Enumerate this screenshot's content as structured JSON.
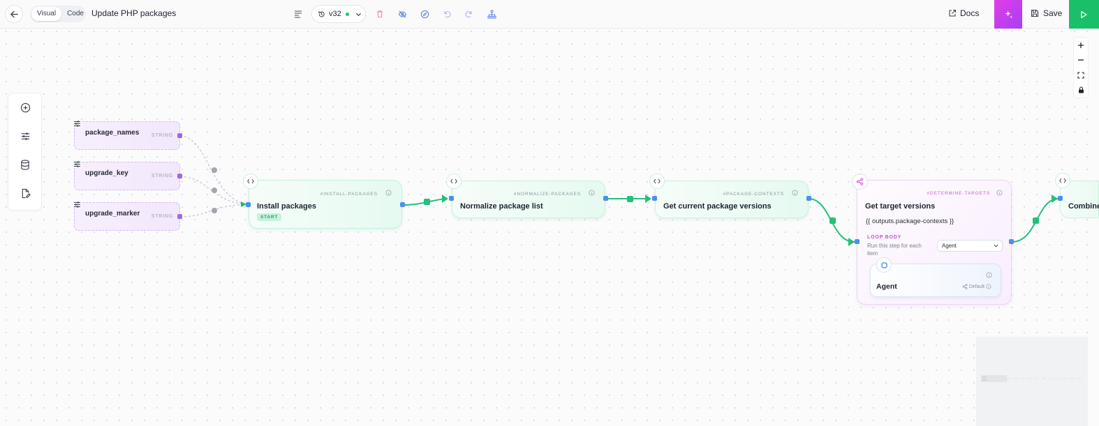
{
  "header": {
    "mode_visual": "Visual",
    "mode_code": "Code",
    "title": "Update PHP packages",
    "version": "v32",
    "docs_label": "Docs",
    "save_label": "Save"
  },
  "inputs": [
    {
      "name": "package_names",
      "type": "STRING"
    },
    {
      "name": "upgrade_key",
      "type": "STRING"
    },
    {
      "name": "upgrade_marker",
      "type": "STRING"
    }
  ],
  "steps": [
    {
      "slug": "#INSTALL-PACKAGES",
      "name": "Install packages",
      "badge": "START"
    },
    {
      "slug": "#NORMALIZE-PACKAGES",
      "name": "Normalize package list"
    },
    {
      "slug": "#PACKAGE-CONTEXTS",
      "name": "Get current package versions"
    },
    {
      "slug": "#DETERMINE-TARGETS",
      "name": "Get target versions",
      "expression": "{{ outputs.package-contexts }}",
      "loop_title": "LOOP BODY",
      "loop_desc": "Run this step for each item",
      "loop_select": "Agent",
      "agent_name": "Agent",
      "agent_default": "Default"
    },
    {
      "name": "Combine"
    }
  ],
  "colors": {
    "accent_green": "#1bbf6a",
    "ai_gradient_start": "#e13de7",
    "loop_purple": "#bf4fd0",
    "handle_blue": "#4a8ff0",
    "handle_purple": "#a066e8"
  }
}
